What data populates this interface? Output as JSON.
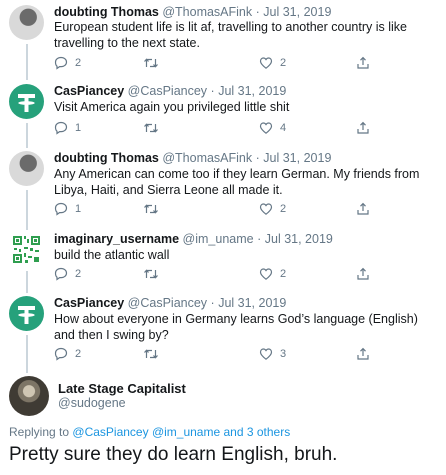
{
  "colors": {
    "link": "#1b95e0",
    "muted": "#657786",
    "thread_line": "#ccd6dd",
    "avatar_green": "#26a17b"
  },
  "tweets": [
    {
      "name": "doubting Thomas",
      "handle": "@ThomasAFink",
      "date": "Jul 31, 2019",
      "separator": "·",
      "text": "European student life is lit af, travelling to another country is like travelling to the next state.",
      "reply_count": "2",
      "retweet_count": "",
      "like_count": "2"
    },
    {
      "name": "CasPiancey",
      "handle": "@CasPiancey",
      "date": "Jul 31, 2019",
      "separator": "·",
      "text": "Visit America again you privileged little shit",
      "reply_count": "1",
      "retweet_count": "",
      "like_count": "4"
    },
    {
      "name": "doubting Thomas",
      "handle": "@ThomasAFink",
      "date": "Jul 31, 2019",
      "separator": "·",
      "text": "Any American can come too if they learn German. My friends from Libya, Haiti, and Sierra Leone all made it.",
      "reply_count": "1",
      "retweet_count": "",
      "like_count": "2"
    },
    {
      "name": "imaginary_username",
      "handle": "@im_uname",
      "date": "Jul 31, 2019",
      "separator": "·",
      "text": "build the atlantic wall",
      "reply_count": "2",
      "retweet_count": "",
      "like_count": "2"
    },
    {
      "name": "CasPiancey",
      "handle": "@CasPiancey",
      "date": "Jul 31, 2019",
      "separator": "·",
      "text": "How about everyone in Germany learns God’s language (English) and then I swing by?",
      "reply_count": "2",
      "retweet_count": "",
      "like_count": "3"
    }
  ],
  "main_tweet": {
    "name": "Late Stage Capitalist",
    "handle": "@sudogene",
    "replying_prefix": "Replying to",
    "replying_to": "@CasPiancey @im_uname",
    "replying_suffix": "and 3 others",
    "text": "Pretty sure they do learn English, bruh."
  }
}
